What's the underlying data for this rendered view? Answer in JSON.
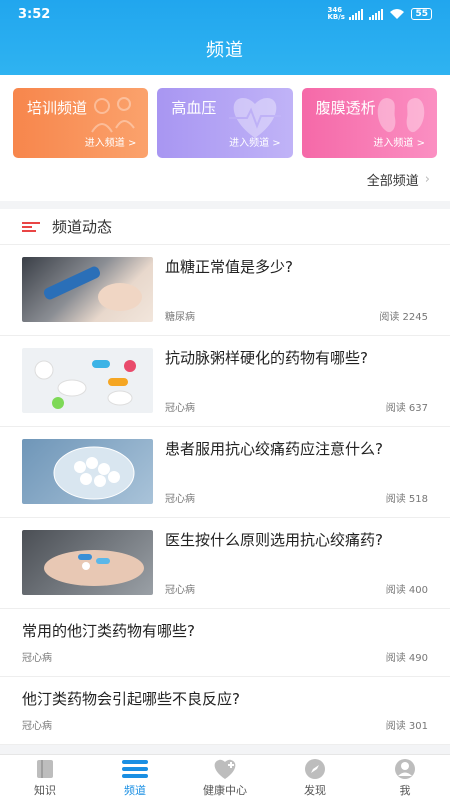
{
  "status": {
    "time": "3:52",
    "net": "346 KB/s",
    "battery": "55"
  },
  "header": {
    "title": "频道"
  },
  "channels": [
    {
      "name": "培训频道",
      "enter": "进入频道 >",
      "color": "#f88d53"
    },
    {
      "name": "高血压",
      "enter": "进入频道 >",
      "color": "#ad9bf3"
    },
    {
      "name": "腹膜透析",
      "enter": "进入频道 >",
      "color": "#f66fad"
    }
  ],
  "all_channels": "全部频道",
  "section": {
    "title": "频道动态"
  },
  "articles": [
    {
      "title": "血糖正常值是多少?",
      "tag": "糖尿病",
      "reads": "阅读 2245"
    },
    {
      "title": "抗动脉粥样硬化的药物有哪些?",
      "tag": "冠心病",
      "reads": "阅读 637"
    },
    {
      "title": "患者服用抗心绞痛药应注意什么?",
      "tag": "冠心病",
      "reads": "阅读 518"
    },
    {
      "title": "医生按什么原则选用抗心绞痛药?",
      "tag": "冠心病",
      "reads": "阅读 400"
    },
    {
      "title": "常用的他汀类药物有哪些?",
      "tag": "冠心病",
      "reads": "阅读 490"
    },
    {
      "title": "他汀类药物会引起哪些不良反应?",
      "tag": "冠心病",
      "reads": "阅读 301"
    }
  ],
  "tabs": [
    {
      "label": "知识",
      "icon": "book-icon"
    },
    {
      "label": "频道",
      "icon": "menu-icon"
    },
    {
      "label": "健康中心",
      "icon": "heart-plus-icon"
    },
    {
      "label": "发现",
      "icon": "compass-icon"
    },
    {
      "label": "我",
      "icon": "user-icon"
    }
  ],
  "colors": {
    "accent": "#1a8fe3",
    "header": "#21a6ee",
    "section_mark": "#e94545"
  }
}
